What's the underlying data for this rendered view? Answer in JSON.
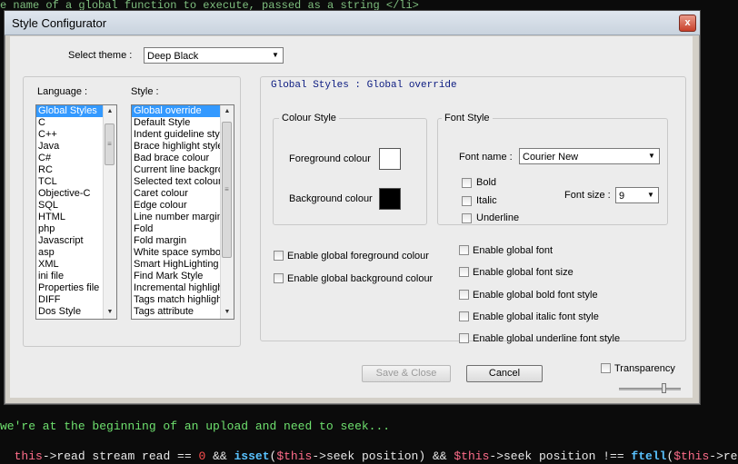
{
  "background_code": {
    "top_line": "e name of a global function to execute, passed as a string </li>",
    "line1": "we're at the beginning of an upload and need to seek...",
    "line2": {
      "this1": "this",
      "arrow1": "->read stream read == ",
      "zero": "0",
      "and1": " && ",
      "isset": "isset",
      "paren1": "(",
      "this2": "$this",
      "seekpos1": "->seek position) && ",
      "this3": "$this",
      "seekpos2": "->seek position !== ",
      "ftell": "ftell",
      "paren2": "(",
      "this4": "$this",
      "tail": "->re"
    }
  },
  "dialog": {
    "title": "Style Configurator",
    "close_label": "x",
    "select_theme_label": "Select theme :",
    "theme_value": "Deep Black",
    "language_label": "Language :",
    "style_label": "Style :",
    "languages": [
      "Global Styles",
      "C",
      "C++",
      "Java",
      "C#",
      "RC",
      "TCL",
      "Objective-C",
      "SQL",
      "HTML",
      "php",
      "Javascript",
      "asp",
      "XML",
      "ini file",
      "Properties file",
      "DIFF",
      "Dos Style"
    ],
    "styles": [
      "Global override",
      "Default Style",
      "Indent guideline style",
      "Brace highlight style",
      "Bad brace colour",
      "Current line background",
      "Selected text colour",
      "Caret colour",
      "Edge colour",
      "Line number margin",
      "Fold",
      "Fold margin",
      "White space symbol",
      "Smart HighLighting",
      "Find Mark Style",
      "Incremental highlight",
      "Tags match highlight",
      "Tags attribute"
    ],
    "panel_header": "Global Styles : Global override",
    "colour_style": {
      "title": "Colour Style",
      "foreground_label": "Foreground colour",
      "background_label": "Background colour",
      "foreground_color": "#ffffff",
      "background_color": "#000000"
    },
    "font_style": {
      "title": "Font Style",
      "font_name_label": "Font name :",
      "font_name_value": "Courier New",
      "bold_label": "Bold",
      "italic_label": "Italic",
      "underline_label": "Underline",
      "font_size_label": "Font size :",
      "font_size_value": "9"
    },
    "enable_global_fg": "Enable global foreground colour",
    "enable_global_bg": "Enable global background colour",
    "enable_global_font": "Enable global font",
    "enable_global_font_size": "Enable global font size",
    "enable_global_bold": "Enable global bold font style",
    "enable_global_italic": "Enable global italic font style",
    "enable_global_underline": "Enable global underline font style",
    "save_close_label": "Save & Close",
    "cancel_label": "Cancel",
    "transparency_label": "Transparency"
  }
}
